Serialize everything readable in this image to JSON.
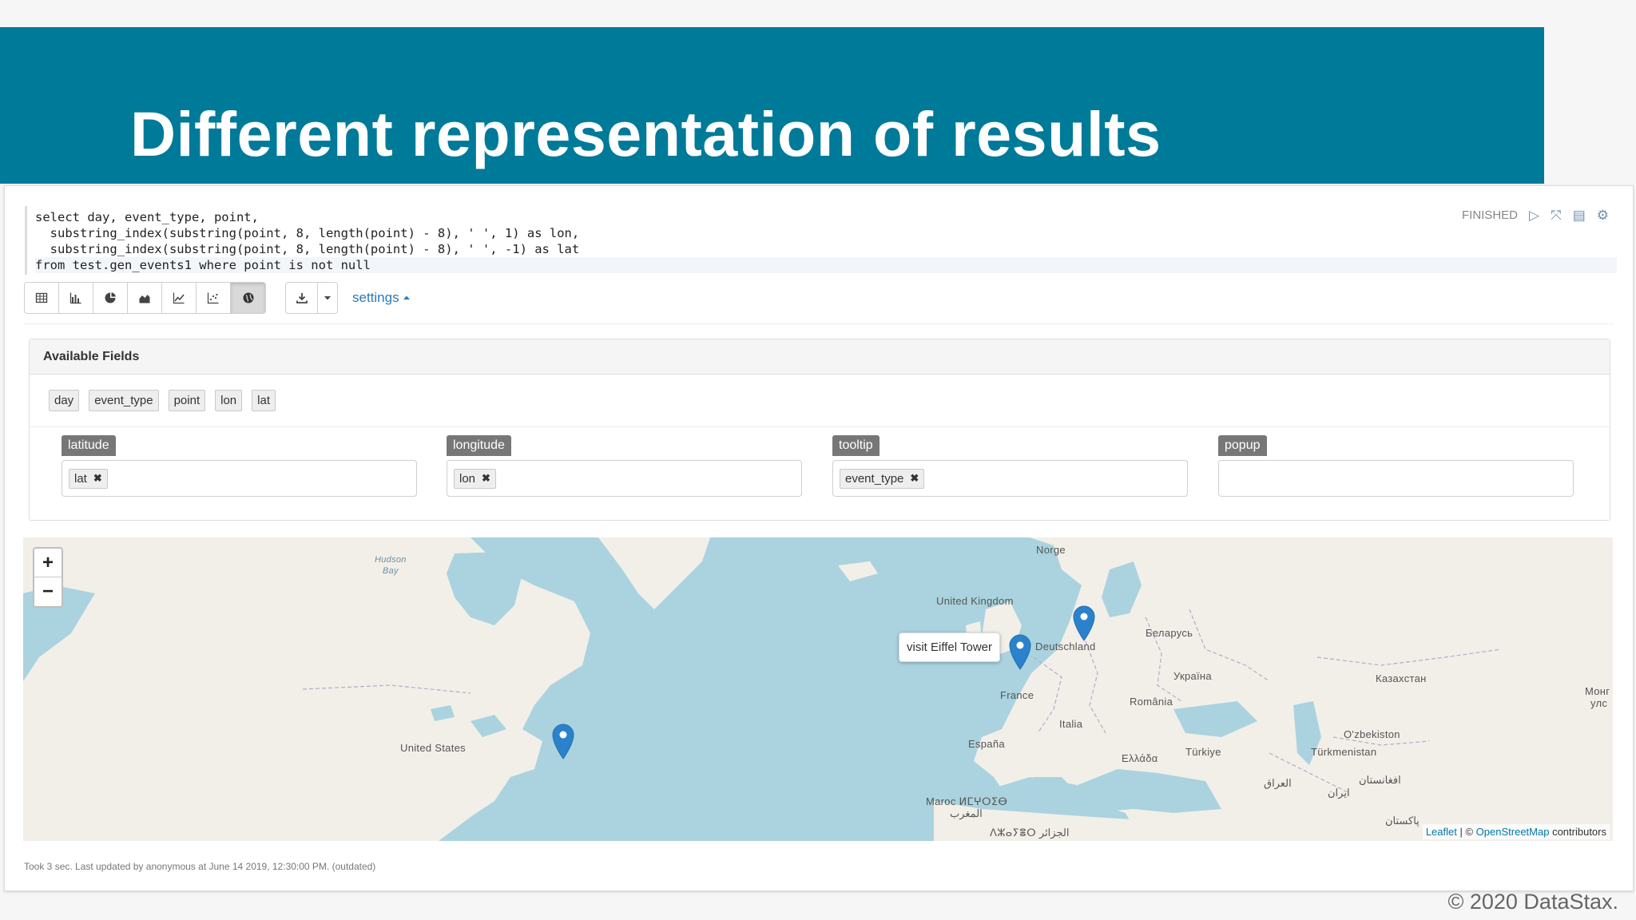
{
  "slide": {
    "title": "Different representation of results",
    "copyright": "© 2020 DataStax."
  },
  "paragraph": {
    "status": "FINISHED",
    "code_lines": [
      "select day, event_type, point,",
      "  substring_index(substring(point, 8, length(point) - 8), ' ', 1) as lon,",
      "  substring_index(substring(point, 8, length(point) - 8), ' ', -1) as lat",
      "from test.gen_events1 where point is not null"
    ],
    "toolbar": {
      "buttons": [
        "table-icon",
        "bar-chart-icon",
        "pie-chart-icon",
        "area-chart-icon",
        "line-chart-icon",
        "scatter-chart-icon",
        "globe-icon"
      ],
      "active": "globe-icon",
      "settings_label": "settings"
    },
    "footer": "Took 3 sec. Last updated by anonymous at June 14 2019, 12:30:00 PM. (outdated)"
  },
  "fields": {
    "heading": "Available Fields",
    "available": [
      "day",
      "event_type",
      "point",
      "lon",
      "lat"
    ],
    "slots": [
      {
        "label": "latitude",
        "value": "lat"
      },
      {
        "label": "longitude",
        "value": "lon"
      },
      {
        "label": "tooltip",
        "value": "event_type"
      },
      {
        "label": "popup",
        "value": ""
      }
    ]
  },
  "map": {
    "labels": {
      "hudson_bay_1": "Hudson",
      "hudson_bay_2": "Bay",
      "norge": "Norge",
      "uk": "United Kingdom",
      "belarus": "Беларусь",
      "deutschland": "Deutschland",
      "ukraina": "Україна",
      "kazakhstan": "Казахстан",
      "mongol_1": "Монг",
      "mongol_2": "улс",
      "france": "France",
      "romania": "România",
      "us": "United States",
      "italia": "Italia",
      "uzbekistan": "O'zbekiston",
      "espana": "España",
      "turkiye": "Türkiye",
      "turkmenistan": "Türkmenistan",
      "ellada": "Ελλάδα",
      "iraq": "العراق",
      "iran": "ایران",
      "afghanistan": "افغانستان",
      "pakistan": "پاکستان",
      "maroc_1": "Maroc ⵍⵎⵖⵔⵉⴱ",
      "maroc_2": "المغرب",
      "algeria": "ⴷⵣⴰⵢⴻⵔ الجزائر"
    },
    "tooltip": "visit Eiffel Tower",
    "zoom_in": "+",
    "zoom_out": "−",
    "attribution_leaflet": "Leaflet",
    "attribution_sep": " | © ",
    "attribution_osm": "OpenStreetMap",
    "attribution_tail": " contributors",
    "marker_color": "#2b82cb",
    "ocean_color": "#aad3df",
    "land_color": "#f2efe9"
  }
}
